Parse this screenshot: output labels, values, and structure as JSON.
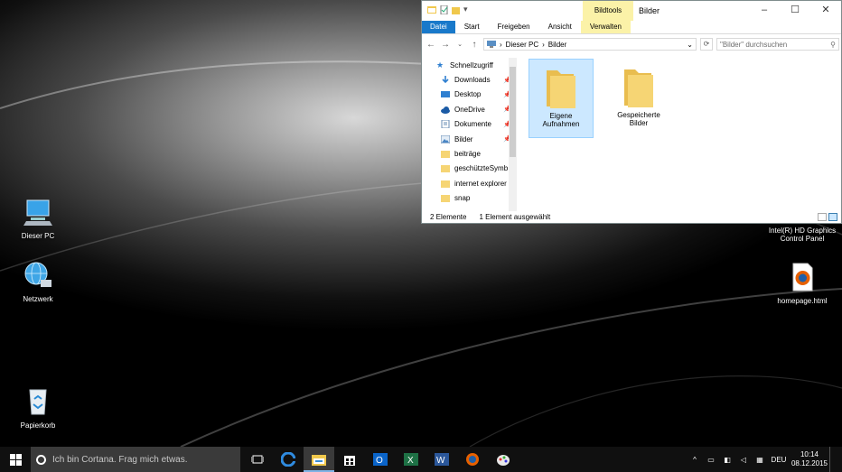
{
  "desktop": {
    "icons": {
      "this_pc": "Dieser PC",
      "network": "Netzwerk",
      "recycle_bin": "Papierkorb",
      "intel_line1": "Intel(R) HD Graphics",
      "intel_line2": "Control Panel",
      "homepage": "homepage.html"
    }
  },
  "explorer": {
    "title": "Bilder",
    "context_tab": "Bildtools",
    "qat_dropdown": "▾",
    "ribbon_tabs": {
      "file": "Datei",
      "start": "Start",
      "share": "Freigeben",
      "view": "Ansicht",
      "manage": "Verwalten"
    },
    "address": {
      "root": "Dieser PC",
      "current": "Bilder",
      "sep": "›",
      "dropdown": "⌄"
    },
    "search_placeholder": "\"Bilder\" durchsuchen",
    "nav_items": [
      {
        "label": "Schnellzugriff",
        "icon": "star-icon"
      },
      {
        "label": "Downloads",
        "icon": "download-arrow-icon",
        "pinned": true
      },
      {
        "label": "Desktop",
        "icon": "desktop-icon",
        "pinned": true
      },
      {
        "label": "OneDrive",
        "icon": "cloud-icon",
        "pinned": true
      },
      {
        "label": "Dokumente",
        "icon": "documents-icon",
        "pinned": true
      },
      {
        "label": "Bilder",
        "icon": "pictures-icon",
        "pinned": true
      },
      {
        "label": "beiträge",
        "icon": "folder-icon"
      },
      {
        "label": "geschützteSymb",
        "icon": "folder-icon"
      },
      {
        "label": "internet explorer",
        "icon": "folder-icon"
      },
      {
        "label": "snap",
        "icon": "folder-icon"
      }
    ],
    "folders": [
      {
        "line1": "Eigene",
        "line2": "Aufnahmen",
        "selected": true
      },
      {
        "line1": "Gespeicherte",
        "line2": "Bilder",
        "selected": false
      }
    ],
    "status": {
      "count": "2 Elemente",
      "selection": "1 Element ausgewählt"
    }
  },
  "taskbar": {
    "cortana_text": "Ich bin Cortana. Frag mich etwas.",
    "apps": [
      "task-view",
      "edge",
      "file-explorer",
      "store",
      "outlook",
      "excel",
      "word",
      "firefox",
      "paint"
    ],
    "tray": {
      "language": "DEU",
      "time": "10:14",
      "date": "08.12.2015",
      "chevron": "^"
    }
  },
  "colors": {
    "accent": "#1979ca",
    "context_tab": "#fbf2a8",
    "selection": "#cce8ff",
    "folder": "#f6d574",
    "taskbar": "#101010"
  }
}
